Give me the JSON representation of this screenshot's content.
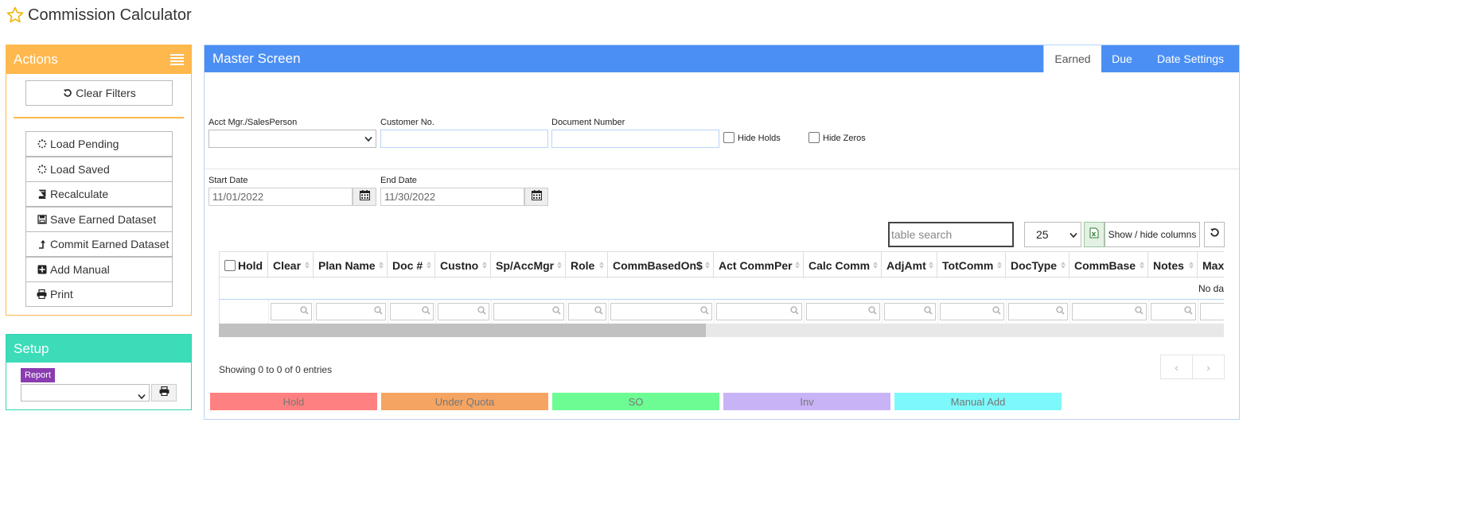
{
  "page": {
    "title": "Commission Calculator"
  },
  "actions": {
    "title": "Actions",
    "clear_filters": "Clear Filters",
    "load_pending": "Load Pending",
    "load_saved": "Load Saved",
    "recalculate": "Recalculate",
    "save_earned": "Save Earned Dataset",
    "commit_earned": "Commit Earned Dataset",
    "add_manual": "Add Manual",
    "print": "Print"
  },
  "setup": {
    "title": "Setup",
    "report_label": "Report",
    "report_value": ""
  },
  "master": {
    "title": "Master Screen",
    "tabs": [
      {
        "label": "Earned",
        "active": true
      },
      {
        "label": "Due",
        "active": false
      },
      {
        "label": "Date Settings",
        "active": false
      }
    ]
  },
  "filters": {
    "acct_mgr_label": "Acct Mgr./SalesPerson",
    "acct_mgr_value": "",
    "customer_no_label": "Customer No.",
    "customer_no_value": "",
    "document_number_label": "Document Number",
    "document_number_value": "",
    "hide_holds_label": "Hide Holds",
    "hide_zeros_label": "Hide Zeros",
    "start_date_label": "Start Date",
    "start_date_value": "11/01/2022",
    "end_date_label": "End Date",
    "end_date_value": "11/30/2022"
  },
  "table": {
    "search_placeholder": "table search",
    "page_size": "25",
    "show_hide_label": "Show / hide columns",
    "columns": [
      "Hold",
      "Clear",
      "Plan Name",
      "Doc #",
      "Custno",
      "Sp/AccMgr",
      "Role",
      "CommBasedOn$",
      "Act CommPer",
      "Calc Comm",
      "AdjAmt",
      "TotComm",
      "DocType",
      "CommBase",
      "Notes",
      "Max"
    ],
    "no_data_text": "No da",
    "showing_text": "Showing 0 to 0 of 0 entries",
    "prev_label": "‹",
    "next_label": "›"
  },
  "legend": [
    {
      "label": "Hold",
      "color": "#ff8080"
    },
    {
      "label": "Under Quota",
      "color": "#f5a462"
    },
    {
      "label": "SO",
      "color": "#6dfc93"
    },
    {
      "label": "Inv",
      "color": "#c8b3f7"
    },
    {
      "label": "Manual Add",
      "color": "#7df9fb"
    }
  ],
  "colors": {
    "actions_accent": "#ffb84d",
    "setup_accent": "#3cdcb8",
    "master_accent": "#4b8ff4",
    "report_badge": "#8a3cb0"
  }
}
